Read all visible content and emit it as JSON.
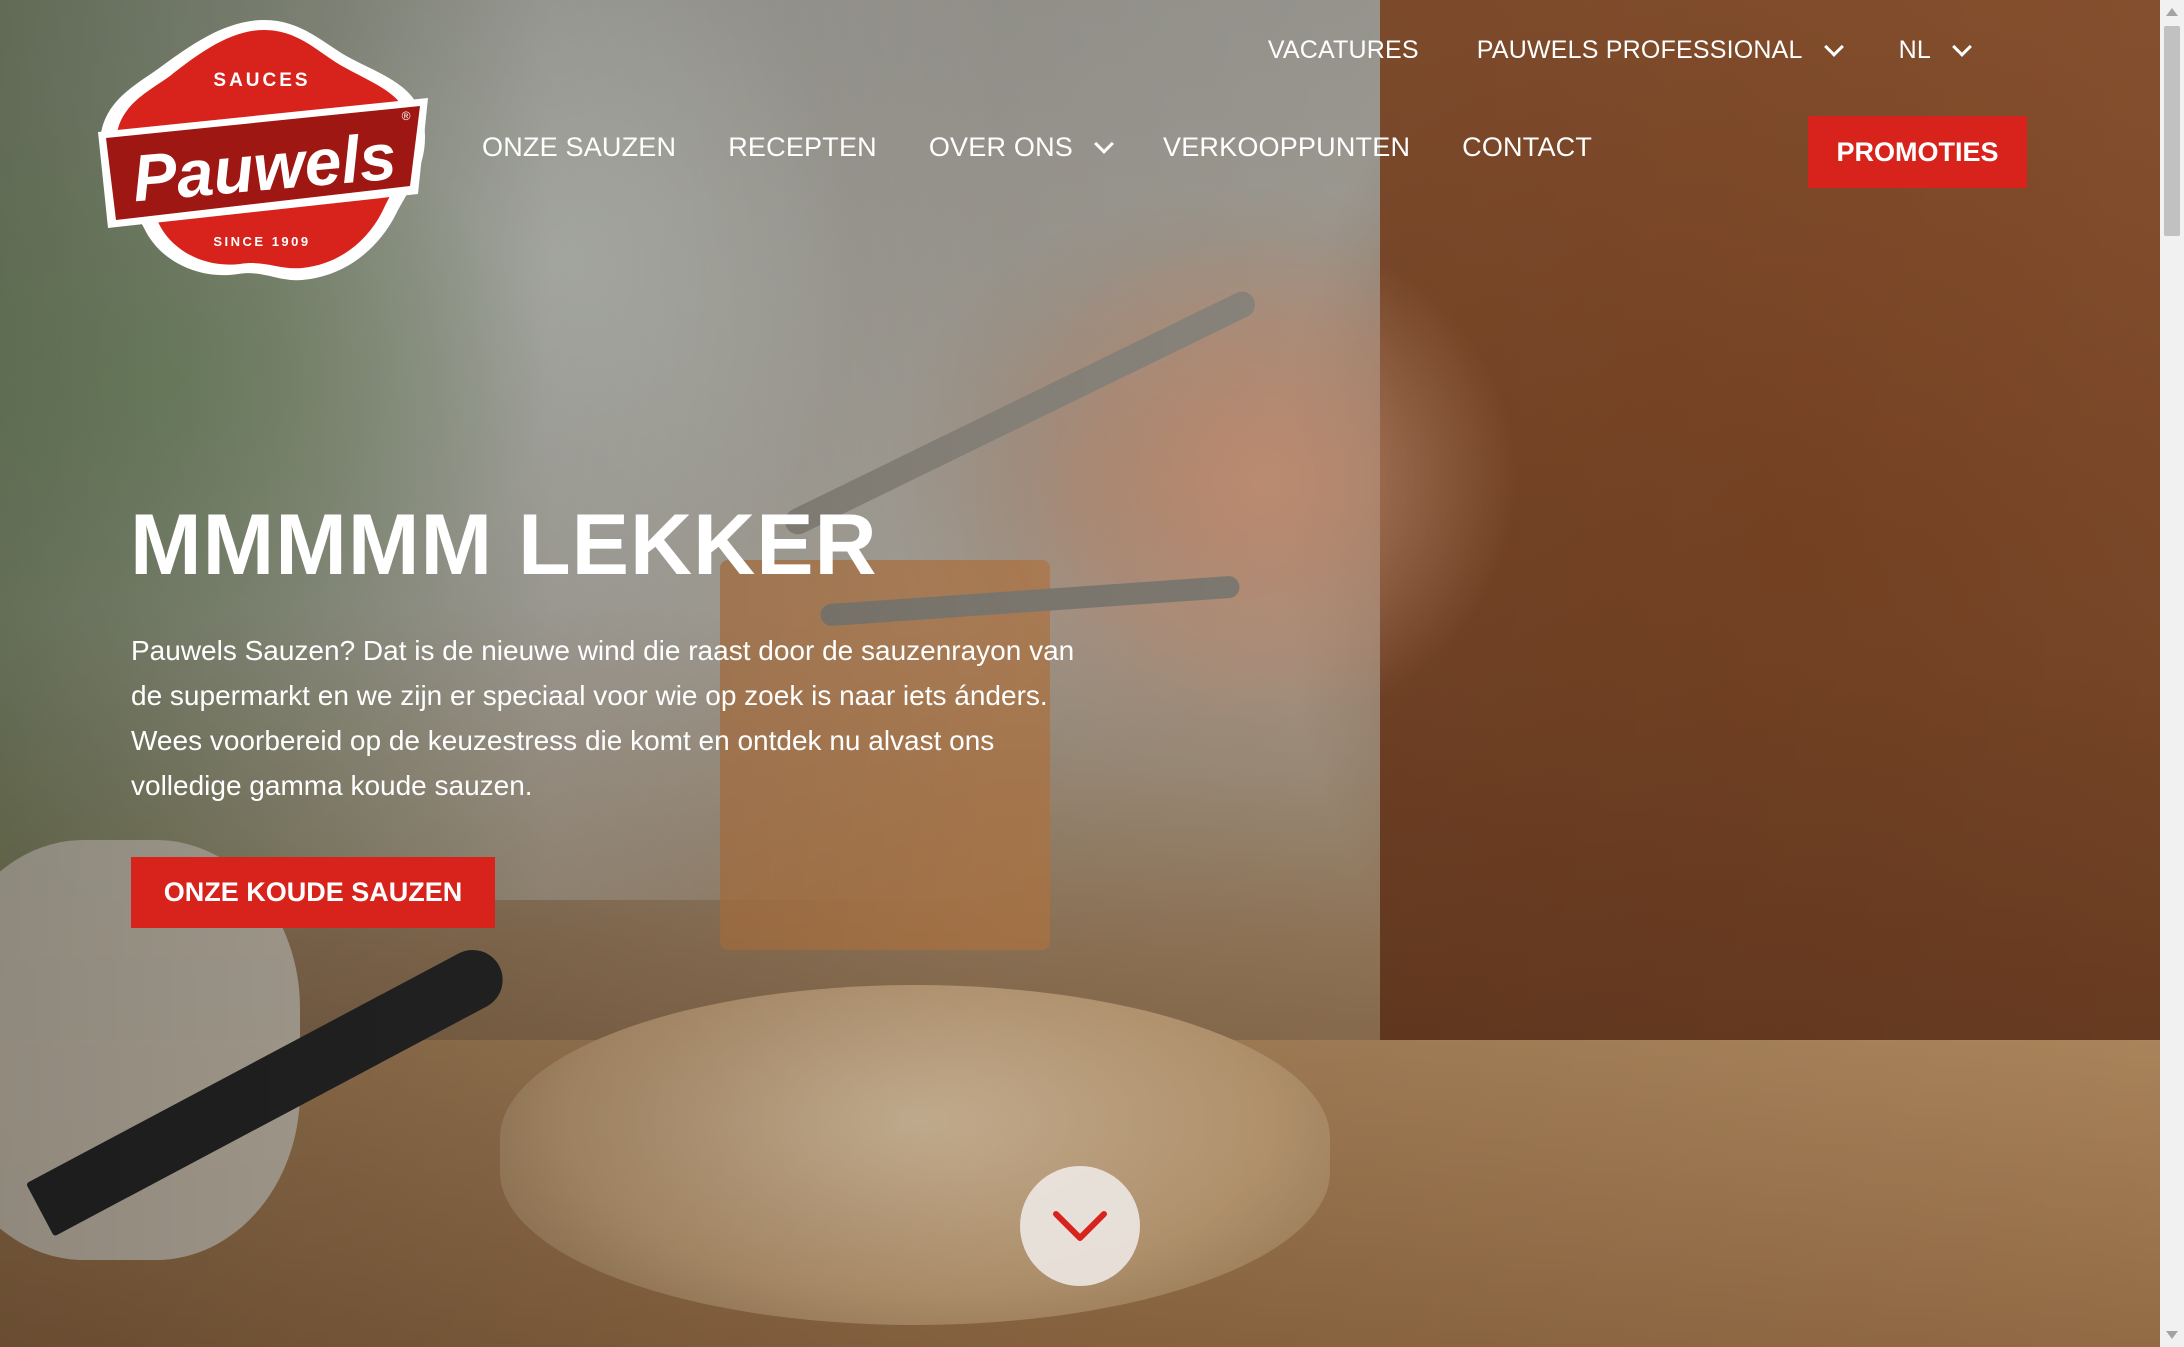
{
  "logo": {
    "top_text": "SAUCES",
    "brand": "Pauwels",
    "registered": "®",
    "since": "SINCE 1909"
  },
  "topnav": {
    "vacatures": "VACATURES",
    "professional": "PAUWELS PROFESSIONAL",
    "language": "NL"
  },
  "mainnav": {
    "items": [
      {
        "label": "ONZE SAUZEN"
      },
      {
        "label": "RECEPTEN"
      },
      {
        "label": "OVER ONS"
      },
      {
        "label": "VERKOOPPUNTEN"
      },
      {
        "label": "CONTACT"
      }
    ],
    "promo": "PROMOTIES"
  },
  "hero": {
    "title": "MMMMM LEKKER",
    "text": "Pauwels Sauzen? Dat is de nieuwe wind die raast door de sauzenrayon van de supermarkt en we zijn er speciaal voor wie op zoek is naar iets ánders. Wees voorbereid op de keuzestress die komt en ontdek nu alvast ons volledige gamma koude sauzen.",
    "cta": "ONZE KOUDE SAUZEN"
  },
  "colors": {
    "brand_red": "#d8231c",
    "text": "#ffffff"
  },
  "icons": {
    "scroll": "chevron-down-icon",
    "dropdown": "chevron-down-icon"
  }
}
